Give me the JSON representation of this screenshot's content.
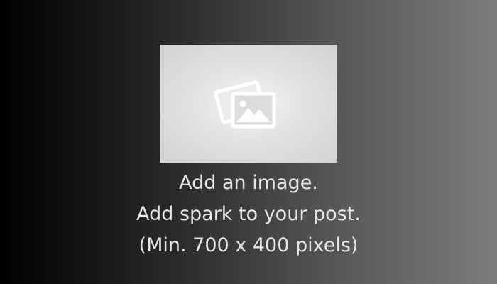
{
  "upload": {
    "icon": "image-icon",
    "line1": "Add an image.",
    "line2": "Add spark to your post.",
    "line3": "(Min. 700 x 400 pixels)"
  },
  "colors": {
    "gradient_start": "#000000",
    "gradient_end": "#7c7c7c",
    "placeholder_fill": "#d8d8d8",
    "icon_color": "#ffffff",
    "text_color": "#e6e6e6"
  }
}
